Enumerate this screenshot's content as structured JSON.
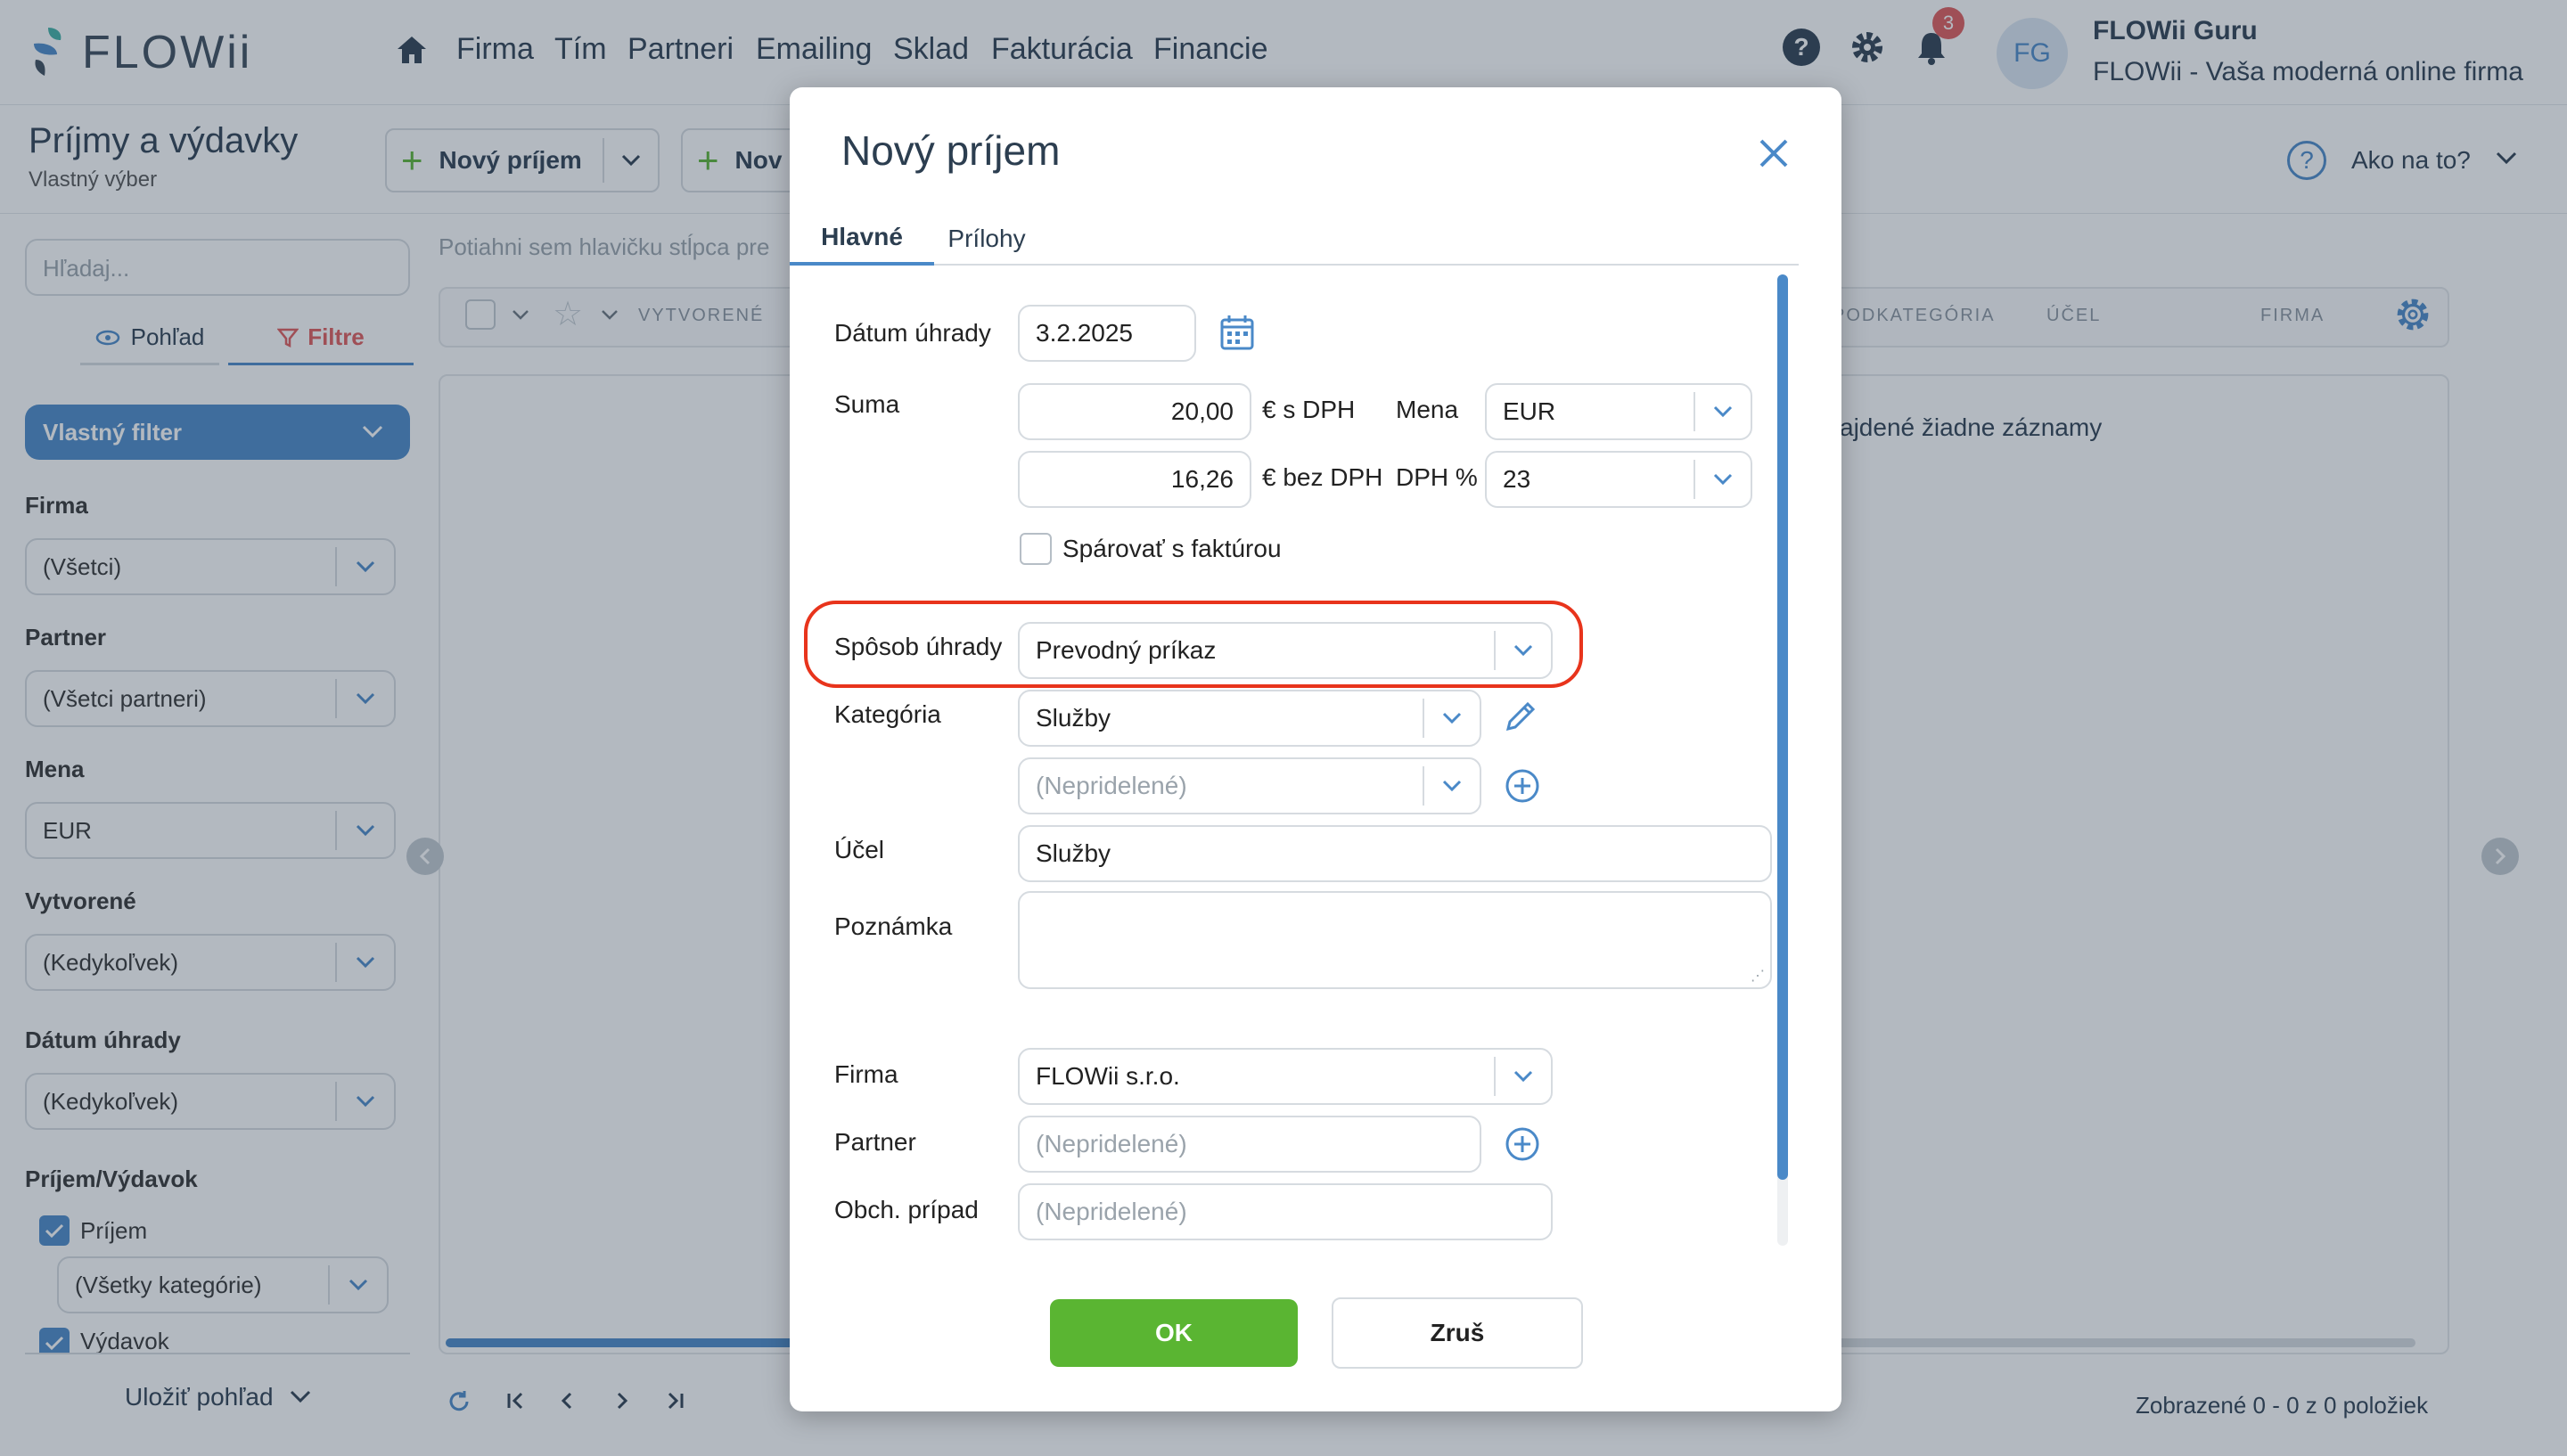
{
  "app": {
    "logo_text": "FLOWii",
    "nav": [
      "Firma",
      "Tím",
      "Partneri",
      "Emailing",
      "Sklad",
      "Fakturácia",
      "Financie"
    ],
    "notification_count": "3",
    "avatar_initials": "FG",
    "user_name": "FLOWii Guru",
    "user_subtitle": "FLOWii - Vaša moderná online firma"
  },
  "page": {
    "title": "Príjmy a výdavky",
    "subtitle": "Vlastný výber",
    "new_income_label": "Nový príjem",
    "new_expense_label_partial": "Nov",
    "help_label": "Ako na to?"
  },
  "sidebar": {
    "search_placeholder": "Hľadaj...",
    "tab_view": "Pohľad",
    "tab_filters": "Filtre",
    "filter_preset": "Vlastný filter",
    "filters": [
      {
        "label": "Firma",
        "value": "(Všetci)"
      },
      {
        "label": "Partner",
        "value": "(Všetci partneri)"
      },
      {
        "label": "Mena",
        "value": "EUR"
      },
      {
        "label": "Vytvorené",
        "value": "(Kedykoľvek)"
      },
      {
        "label": "Dátum úhrady",
        "value": "(Kedykoľvek)"
      }
    ],
    "income_expense_label": "Príjem/Výdavok",
    "income_label": "Príjem",
    "income_categories": "(Všetky kategórie)",
    "expense_label": "Výdavok",
    "save_view": "Uložiť pohľad"
  },
  "grid": {
    "drag_hint": "Potiahni sem hlavičku stĺpca pre",
    "columns": [
      "VYTVORENÉ",
      "PODKATEGÓRIA",
      "ÚČEL",
      "FIRMA"
    ],
    "empty_text": "ajdené žiadne záznamy",
    "footer_status": "Zobrazené 0 - 0 z 0 položiek"
  },
  "modal": {
    "title": "Nový príjem",
    "tabs": [
      "Hlavné",
      "Prílohy"
    ],
    "payment_date_label": "Dátum úhrady",
    "payment_date_value": "3.2.2025",
    "sum_label": "Suma",
    "sum_with_vat": "20,00",
    "with_vat_suffix": "€ s DPH",
    "currency_label": "Mena",
    "currency_value": "EUR",
    "sum_without_vat": "16,26",
    "without_vat_suffix": "€ bez DPH",
    "vat_label": "DPH %",
    "vat_value": "23",
    "pair_invoice_label": "Spárovať s faktúrou",
    "payment_method_label": "Spôsob úhrady",
    "payment_method_value": "Prevodný príkaz",
    "category_label": "Kategória",
    "category_value": "Služby",
    "subcategory_placeholder": "(Nepridelené)",
    "purpose_label": "Účel",
    "purpose_value": "Služby",
    "note_label": "Poznámka",
    "company_label": "Firma",
    "company_value": "FLOWii s.r.o.",
    "partner_label": "Partner",
    "partner_placeholder": "(Nepridelené)",
    "case_label": "Obch. prípad",
    "case_placeholder": "(Nepridelené)",
    "ok_label": "OK",
    "cancel_label": "Zruš"
  },
  "colors": {
    "accent_blue": "#4a89c8",
    "ok_green": "#5ab532",
    "highlight_red": "#e8341c",
    "logo_teal": "#3fb0a5"
  }
}
